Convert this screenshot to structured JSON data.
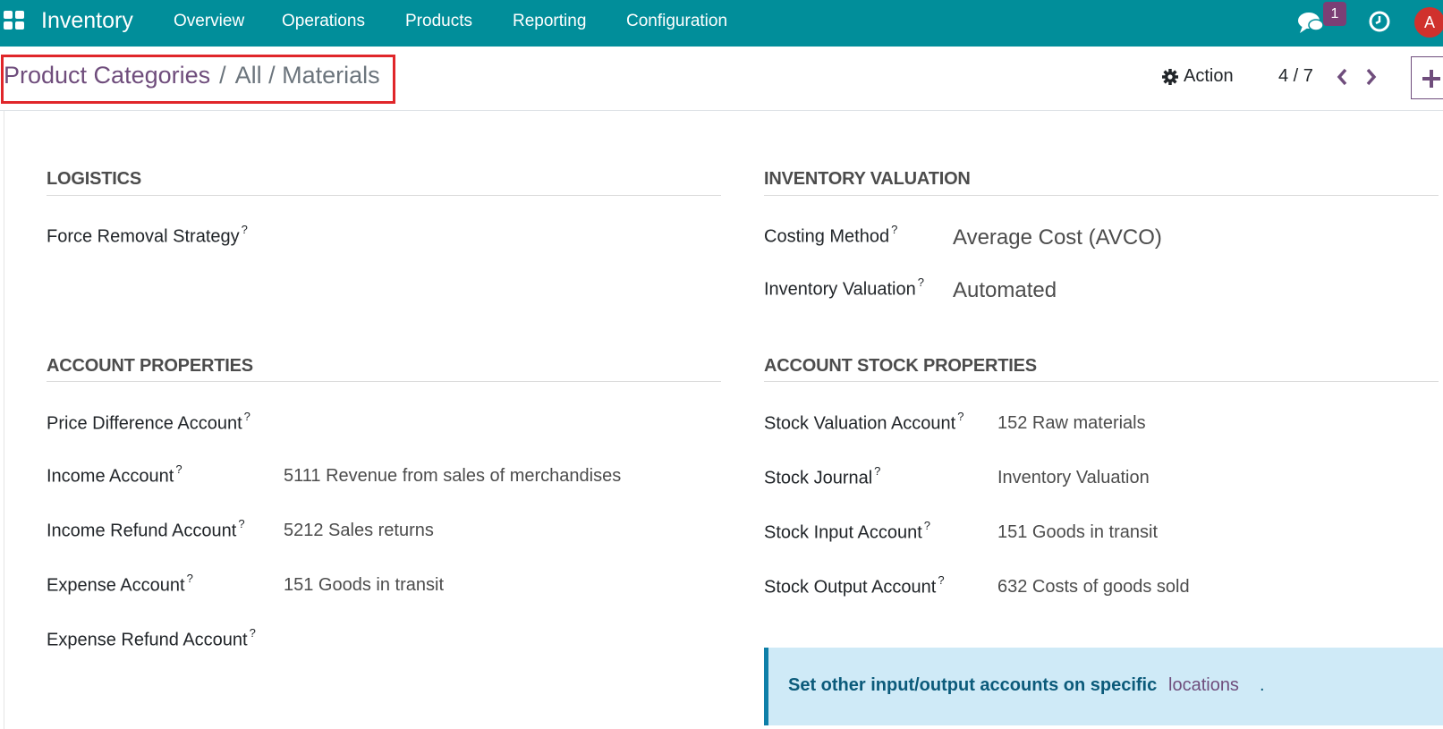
{
  "navbar": {
    "app_name": "Inventory",
    "menu": [
      "Overview",
      "Operations",
      "Products",
      "Reporting",
      "Configuration"
    ],
    "chat_badge": "1",
    "avatar_initial": "A",
    "background_color": "#018e9a"
  },
  "control_panel": {
    "breadcrumb": {
      "root": "Product Categories",
      "separator": "/",
      "current": "All / Materials"
    },
    "action_label": "Action",
    "pager": "4 / 7"
  },
  "form": {
    "logistics": {
      "title": "LOGISTICS",
      "fields": [
        {
          "label": "Force Removal Strategy",
          "help": "?",
          "value": ""
        }
      ]
    },
    "inventory_valuation": {
      "title": "INVENTORY VALUATION",
      "fields": [
        {
          "label": "Costing Method",
          "help": "?",
          "value": "Average Cost (AVCO)"
        },
        {
          "label": "Inventory Valuation",
          "help": "?",
          "value": "Automated"
        }
      ]
    },
    "account_properties": {
      "title": "ACCOUNT PROPERTIES",
      "fields": [
        {
          "label": "Price Difference Account",
          "help": "?",
          "value": ""
        },
        {
          "label": "Income Account",
          "help": "?",
          "value": "5111 Revenue from sales of merchandises"
        },
        {
          "label": "Income Refund Account",
          "help": "?",
          "value": "5212 Sales returns"
        },
        {
          "label": "Expense Account",
          "help": "?",
          "value": "151 Goods in transit"
        },
        {
          "label": "Expense Refund Account",
          "help": "?",
          "value": ""
        }
      ]
    },
    "account_stock_properties": {
      "title": "ACCOUNT STOCK PROPERTIES",
      "fields": [
        {
          "label": "Stock Valuation Account",
          "help": "?",
          "value": "152 Raw materials"
        },
        {
          "label": "Stock Journal",
          "help": "?",
          "value": "Inventory Valuation"
        },
        {
          "label": "Stock Input Account",
          "help": "?",
          "value": "151 Goods in transit"
        },
        {
          "label": "Stock Output Account",
          "help": "?",
          "value": "632 Costs of goods sold"
        }
      ]
    },
    "alert": {
      "text": "Set other input/output accounts on specific",
      "link": "locations",
      "end": "."
    }
  },
  "colors": {
    "accent": "#6f4d7c",
    "highlight_box": "#e0262a",
    "alert_bg": "#cfeaf7"
  }
}
